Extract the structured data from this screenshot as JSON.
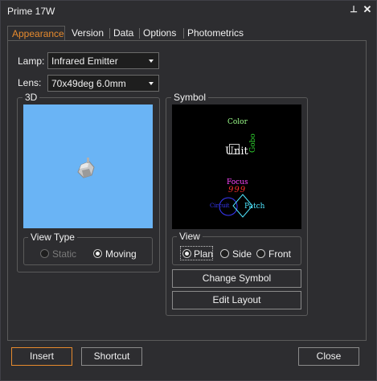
{
  "window": {
    "title": "Prime 17W",
    "pin_glyph": "⊥",
    "close_glyph": "✕"
  },
  "tabs": [
    {
      "label": "Appearance",
      "active": true
    },
    {
      "label": "Version",
      "active": false
    },
    {
      "label": "Data",
      "active": false
    },
    {
      "label": "Options",
      "active": false
    },
    {
      "label": "Photometrics",
      "active": false
    }
  ],
  "lamp": {
    "label": "Lamp:",
    "value": "Infrared Emitter"
  },
  "lens": {
    "label": "Lens:",
    "value": "70x49deg 6.0mm"
  },
  "group3d": {
    "title": "3D",
    "view_type": {
      "title": "View Type",
      "options": [
        {
          "label": "Static",
          "checked": false,
          "enabled": false
        },
        {
          "label": "Moving",
          "checked": true,
          "enabled": true
        }
      ]
    }
  },
  "symbol": {
    "title": "Symbol",
    "labels": {
      "color": "Color",
      "unit": "Unit",
      "gobo": "Gobo",
      "focus": "Focus",
      "focus_value": "999",
      "circuit": "Circuit",
      "patch": "Patch"
    },
    "colors": {
      "color": "#9cff8a",
      "unit": "#ffffff",
      "gobo": "#2fd32f",
      "focus": "#ff44ff",
      "focus_value": "#ff3030",
      "circuit": "#3a3aff",
      "patch": "#4fe6ff"
    },
    "view": {
      "title": "View",
      "options": [
        {
          "label": "Plan",
          "checked": true
        },
        {
          "label": "Side",
          "checked": false
        },
        {
          "label": "Front",
          "checked": false
        }
      ]
    },
    "change_button": "Change Symbol",
    "edit_button": "Edit Layout"
  },
  "footer": {
    "insert": "Insert",
    "shortcut": "Shortcut",
    "close": "Close"
  },
  "accent_color": "#e68a2e"
}
